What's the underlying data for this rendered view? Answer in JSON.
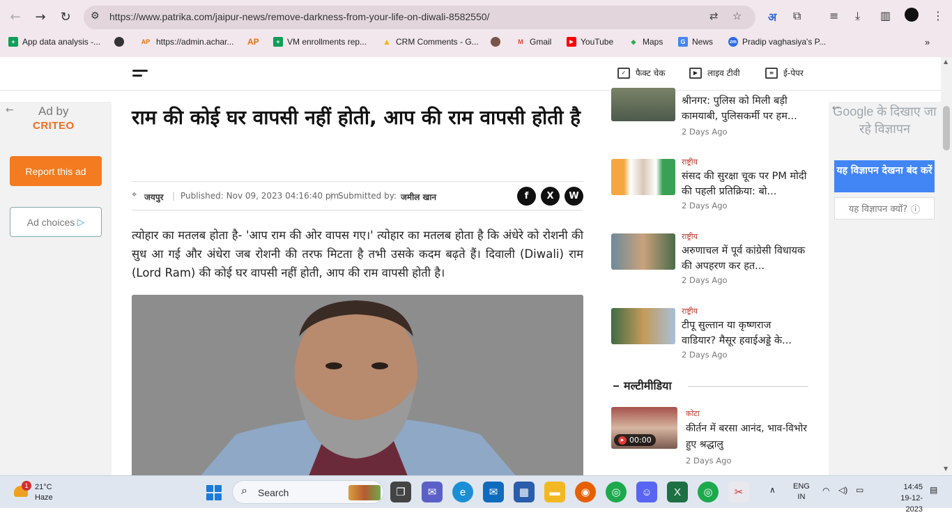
{
  "browser": {
    "url": "https://www.patrika.com/jaipur-news/remove-darkness-from-your-life-on-diwali-8582550/",
    "bookmarks": [
      {
        "label": "App data analysis -...",
        "color": "#0f9d58",
        "glyph": "+"
      },
      {
        "label": "",
        "color": "#333333",
        "glyph": "●"
      },
      {
        "label": "https://admin.achar...",
        "color": "#e8710a",
        "glyph": "AP"
      },
      {
        "label": "AP",
        "color": "#e8710a",
        "glyph": ""
      },
      {
        "label": "VM enrollments rep...",
        "color": "#0f9d58",
        "glyph": "+"
      },
      {
        "label": "CRM Comments - G...",
        "color": "#f4b400",
        "glyph": "▲"
      },
      {
        "label": "",
        "color": "#795548",
        "glyph": "●"
      },
      {
        "label": "Gmail",
        "color": "#ea4335",
        "glyph": "M"
      },
      {
        "label": "YouTube",
        "color": "#ff0000",
        "glyph": "▶"
      },
      {
        "label": "Maps",
        "color": "#34a853",
        "glyph": "◆"
      },
      {
        "label": "News",
        "color": "#4285f4",
        "glyph": "G"
      },
      {
        "label": "Pradip vaghasiya's P...",
        "color": "#2d6be4",
        "glyph": "zm"
      }
    ]
  },
  "header": {
    "nav": [
      {
        "label": "फैक्ट चेक",
        "icon": "fact-check-icon"
      },
      {
        "label": "लाइव टीवी",
        "icon": "live-tv-icon"
      },
      {
        "label": "ई-पेपर",
        "icon": "epaper-icon"
      }
    ]
  },
  "left_ad": {
    "ad_by": "Ad by",
    "brand": "CRITEO",
    "report": "Report this ad",
    "choices": "Ad choices"
  },
  "article": {
    "headline": "राम की कोई घर वापसी नहीं होती, आप की राम वापसी होती है",
    "location": "जयपुर",
    "published": "Published: Nov 09, 2023 04:16:40 pm",
    "submitted_label": "Submitted by:",
    "author": "जमील खान",
    "body": "त्योहार का मतलब होता है- 'आप राम की ओर वापस गए।' त्योहार का मतलब होता है कि अंधेरे को रोशनी की सुध आ गई और अंधेरा जब रोशनी की तरफ मिटता है तभी उसके कदम बढ़ते हैं। दिवाली (Diwali) राम (Lord Ram) की कोई घर वापसी नहीं होती, आप की राम वापसी होती है।",
    "share": [
      "f",
      "X",
      "W"
    ]
  },
  "sidebar": {
    "stories": [
      {
        "category": "",
        "title": "श्रीनगर: पुलिस को मिली बड़ी कामयाबी, पुलिसकर्मी पर हम...",
        "time": "2 Days Ago"
      },
      {
        "category": "राष्ट्रीय",
        "title": "संसद की सुरक्षा चूक पर PM मोदी की पहली प्रतिक्रिया: बो...",
        "time": "2 Days Ago"
      },
      {
        "category": "राष्ट्रीय",
        "title": "अरुणाचल में पूर्व कांग्रेसी विधायक की अपहरण कर हत...",
        "time": "2 Days Ago"
      },
      {
        "category": "राष्ट्रीय",
        "title": "टीपू सुल्तान या कृष्णराज वाडियार? मैसूर हवाईअड्डे के...",
        "time": "2 Days Ago"
      }
    ],
    "multimedia_title": "मल्टीमीडिया",
    "multimedia": {
      "category": "कोटा",
      "title": "कीर्तन में बरसा आनंद, भाव-विभोर हुए श्रद्धालु",
      "time": "2 Days Ago",
      "duration": "00:00"
    }
  },
  "right_ad": {
    "google_line": "Google के दिखाए जा रहे विज्ञापन",
    "stop": "यह विज्ञापन देखना बंद करें",
    "why": "यह विज्ञापन क्यों?"
  },
  "taskbar": {
    "temp": "21°C",
    "condition": "Haze",
    "weather_badge": "1",
    "search": "Search",
    "lang1": "ENG",
    "lang2": "IN",
    "time": "14:45",
    "date": "19-12-2023"
  }
}
